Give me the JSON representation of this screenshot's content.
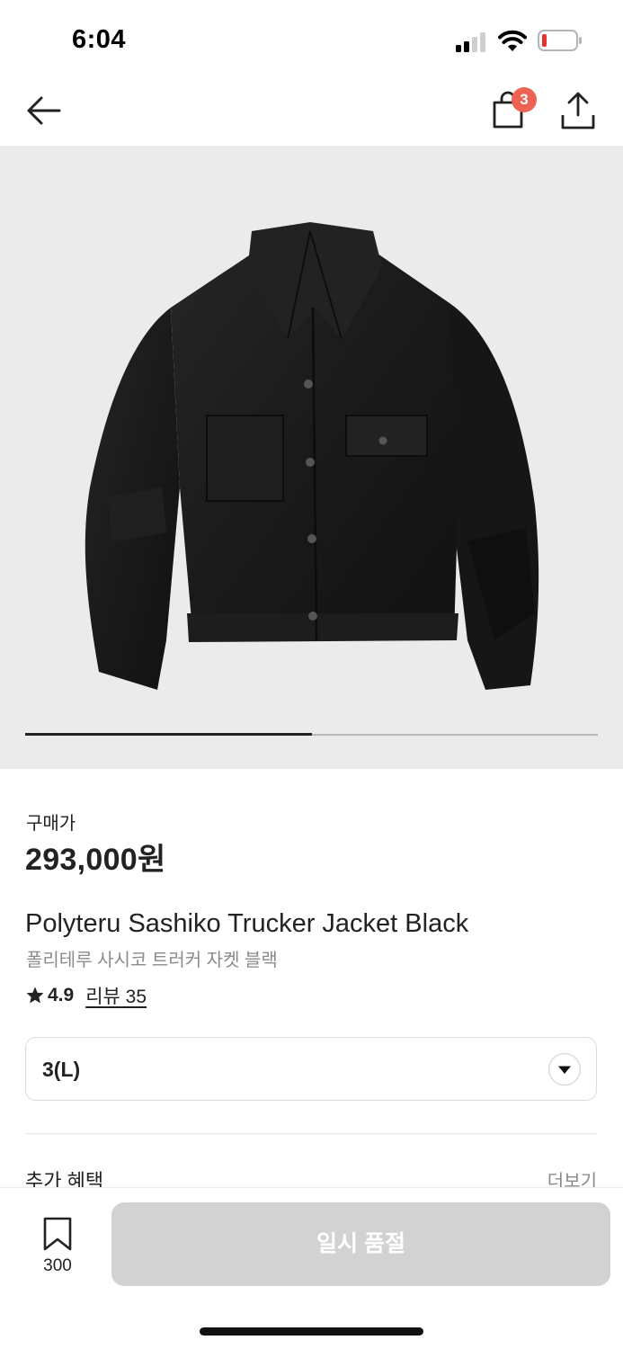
{
  "status_bar": {
    "time": "6:04"
  },
  "nav": {
    "cart_count": "3"
  },
  "gallery": {
    "progress": 0.5
  },
  "product": {
    "price_label": "구매가",
    "price": "293,000원",
    "name_en": "Polyteru Sashiko Trucker Jacket Black",
    "name_ko": "폴리테루 사시코 트러커 자켓 블랙",
    "rating": "4.9",
    "reviews": "리뷰 35"
  },
  "option": {
    "selected": "3(L)"
  },
  "benefits": {
    "title": "추가 혜택",
    "more": "더보기"
  },
  "bottom": {
    "bookmark_count": "300",
    "buy_label": "일시 품절"
  },
  "icons": [
    "back-arrow-icon",
    "shopping-bag-icon",
    "share-icon",
    "star-icon",
    "chevron-down-icon",
    "bookmark-icon"
  ],
  "colors": {
    "badge": "#ef6253",
    "disabled_button": "#d2d2d2",
    "image_bg": "#ebebeb",
    "muted_text": "#8b8b8b"
  }
}
